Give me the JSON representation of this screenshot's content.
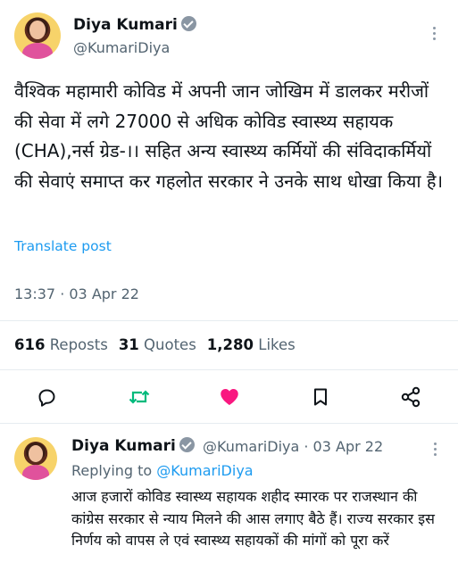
{
  "tweet": {
    "author_name": "Diya Kumari",
    "author_handle": "@KumariDiya",
    "text": "वैश्विक महामारी कोविड में अपनी जान जोखिम में डालकर मरीजों की सेवा में लगे 27000 से अधिक कोविड स्वास्थ्य सहायक (CHA),नर्स ग्रेड-।। सहित अन्य स्वास्थ्य कर्मियों की संविदाकर्मियों की सेवाएं समाप्त कर गहलोत सरकार ने उनके साथ धोखा किया है।",
    "translate_label": "Translate post",
    "timestamp": "13:37 · 03 Apr 22"
  },
  "stats": {
    "reposts_count": "616",
    "reposts_label": "Reposts",
    "quotes_count": "31",
    "quotes_label": "Quotes",
    "likes_count": "1,280",
    "likes_label": "Likes"
  },
  "actions": {
    "reply_icon": "speech-bubble-icon",
    "repost_icon": "repost-arrows-icon",
    "like_icon": "heart-icon",
    "like_active": true,
    "bookmark_icon": "bookmark-icon",
    "share_icon": "share-icon"
  },
  "reply": {
    "author_name": "Diya Kumari",
    "author_handle_date": "@KumariDiya · 03 Apr 22",
    "replying_prefix": "Replying to",
    "replying_mention": "@KumariDiya",
    "text": "आज हजारों कोविड स्वास्थ्य सहायक शहीद स्मारक पर राजस्थान की कांग्रेस सरकार से न्याय मिलने की आस लगाए बैठे हैं।  राज्य सरकार इस निर्णय को वापस ले एवं स्वास्थ्य सहायकों की मांगों को पूरा करें"
  },
  "colors": {
    "accent_blue": "#1d9bf0",
    "repost_green": "#00ba7c",
    "like_pink": "#f91880",
    "secondary_text": "#536471"
  }
}
